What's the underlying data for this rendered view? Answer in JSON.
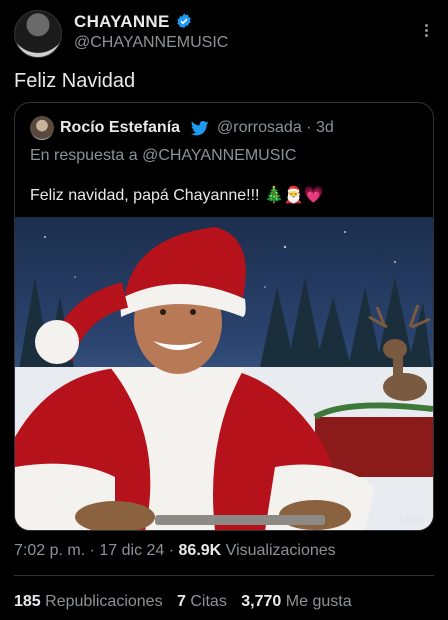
{
  "author": {
    "display_name": "CHAYANNE",
    "handle": "@CHAYANNEMUSIC",
    "verified_color": "#1d9bf0"
  },
  "tweet": {
    "text": "Feliz Navidad"
  },
  "quoted": {
    "display_name": "Rocío Estefanía",
    "handle_time": "@rorrosada · 3d",
    "reply_to": "En respuesta a @CHAYANNEMUSIC",
    "text": "Feliz navidad, papá Chayanne!!!",
    "emojis": "🎄🎅💗",
    "image_watermark": "GROK"
  },
  "meta": {
    "time": "7:02 p. m. · 17 dic 24 · ",
    "views_count": "86.9K",
    "views_label": " Visualizaciones"
  },
  "stats": {
    "reposts_count": "185",
    "reposts_label": "Republicaciones",
    "quotes_count": "7",
    "quotes_label": "Citas",
    "likes_count": "3,770",
    "likes_label": "Me gusta"
  },
  "icons": [
    "verified-badge-icon",
    "more-options-icon",
    "twitter-bird-icon"
  ]
}
